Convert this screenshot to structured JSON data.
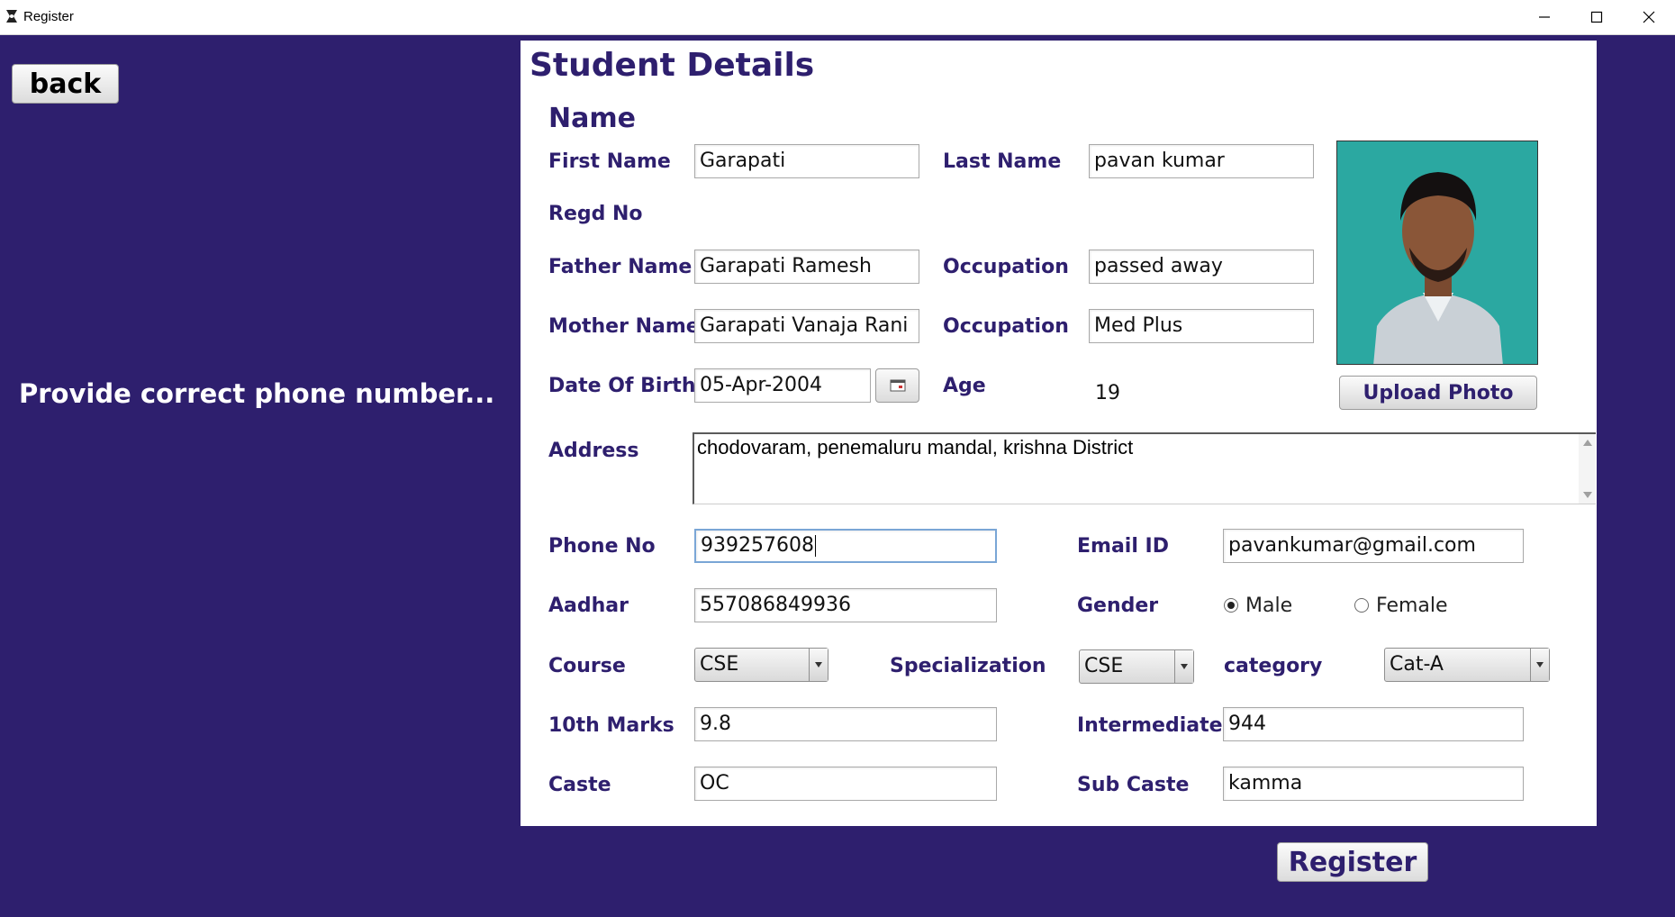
{
  "window": {
    "title": "Register",
    "icon": "app-icon"
  },
  "back_label": "back",
  "message": "Provide correct phone number...",
  "form": {
    "heading": "Student Details",
    "name_section": "Name",
    "labels": {
      "first_name": "First Name",
      "last_name": "Last Name",
      "regd_no": "Regd No",
      "father_name": "Father Name",
      "father_occupation": "Occupation",
      "mother_name": "Mother Name",
      "mother_occupation": "Occupation",
      "dob": "Date Of Birth",
      "age": "Age",
      "address": "Address",
      "phone": "Phone No",
      "email": "Email ID",
      "aadhar": "Aadhar",
      "gender": "Gender",
      "course": "Course",
      "specialization": "Specialization",
      "category": "category",
      "tenth": "10th Marks",
      "intermediate": "Intermediate",
      "caste": "Caste",
      "sub_caste": "Sub Caste"
    },
    "values": {
      "first_name": "Garapati",
      "last_name": "pavan kumar",
      "father_name": "Garapati Ramesh",
      "father_occupation": "passed away",
      "mother_name": "Garapati Vanaja Rani",
      "mother_occupation": "Med Plus",
      "dob": "05-Apr-2004",
      "age": "19",
      "address": "chodovaram, penemaluru mandal, krishna District",
      "phone": "939257608",
      "email": "pavankumar@gmail.com",
      "aadhar": "557086849936",
      "course": "CSE",
      "specialization": "CSE",
      "category": "Cat-A",
      "tenth": "9.8",
      "intermediate": "944",
      "caste": "OC",
      "sub_caste": "kamma"
    },
    "gender_options": {
      "male": "Male",
      "female": "Female",
      "selected": "Male"
    },
    "upload_label": "Upload Photo"
  },
  "register_label": "Register"
}
